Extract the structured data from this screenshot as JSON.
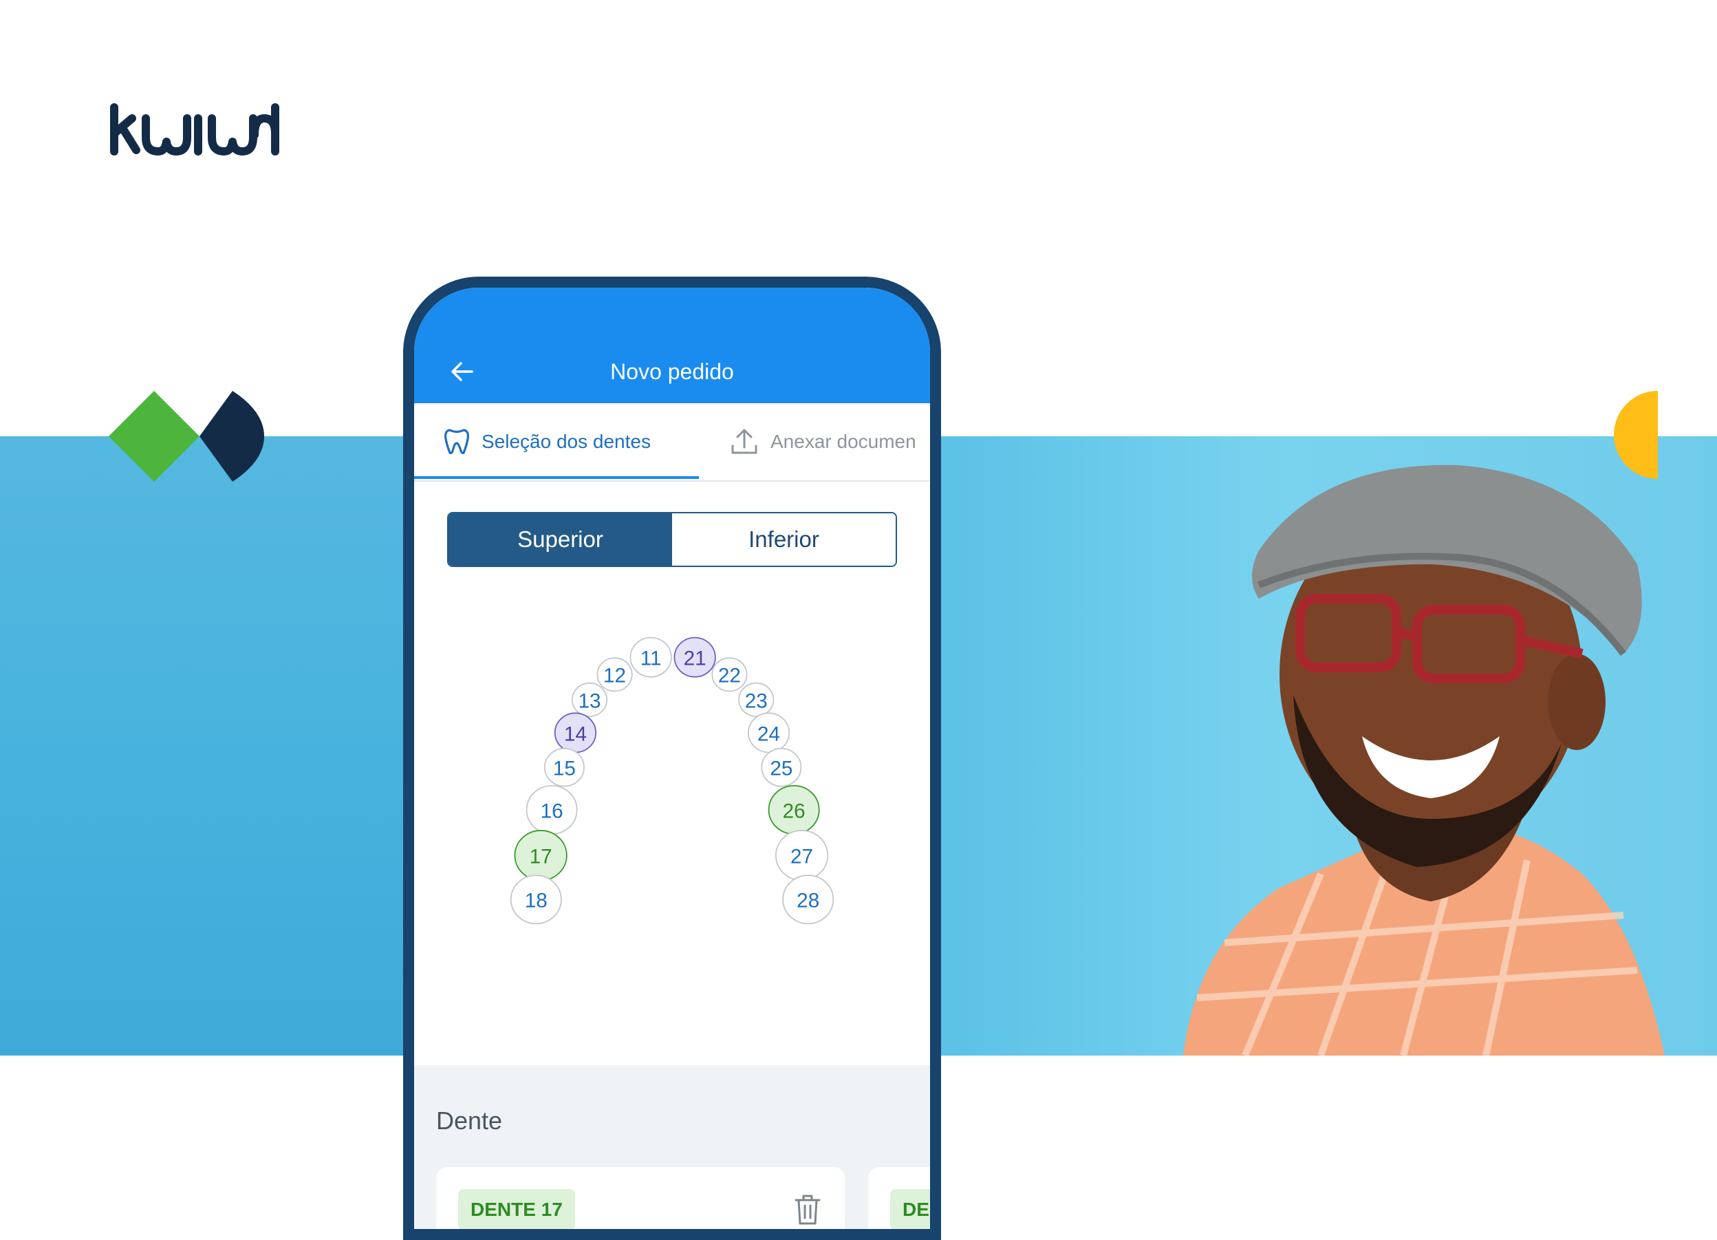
{
  "brand": {
    "logo_text": "kiwid",
    "accent_green": "#4db53c",
    "navy": "#132b47",
    "yellow": "#ffbd17",
    "band_blue": "#4ab3df"
  },
  "app": {
    "title": "Novo pedido",
    "back_icon": "arrow-left-icon",
    "tabs": [
      {
        "label": "Seleção dos dentes",
        "icon": "tooth-icon",
        "active": true
      },
      {
        "label": "Anexar documen",
        "icon": "upload-icon",
        "active": false
      }
    ],
    "segment": {
      "options": [
        "Superior",
        "Inferior"
      ],
      "selected": "Superior"
    },
    "teeth": [
      {
        "number": "11",
        "state": "default"
      },
      {
        "number": "12",
        "state": "default"
      },
      {
        "number": "13",
        "state": "default"
      },
      {
        "number": "14",
        "state": "purple"
      },
      {
        "number": "15",
        "state": "default"
      },
      {
        "number": "16",
        "state": "default"
      },
      {
        "number": "17",
        "state": "green"
      },
      {
        "number": "18",
        "state": "default"
      },
      {
        "number": "21",
        "state": "purple"
      },
      {
        "number": "22",
        "state": "default"
      },
      {
        "number": "23",
        "state": "default"
      },
      {
        "number": "24",
        "state": "default"
      },
      {
        "number": "25",
        "state": "default"
      },
      {
        "number": "26",
        "state": "green"
      },
      {
        "number": "27",
        "state": "default"
      },
      {
        "number": "28",
        "state": "default"
      }
    ],
    "section_title": "Dente",
    "cards": [
      {
        "chip": "DENTE 17",
        "action_icon": "trash-icon"
      },
      {
        "chip": "DE"
      }
    ]
  }
}
